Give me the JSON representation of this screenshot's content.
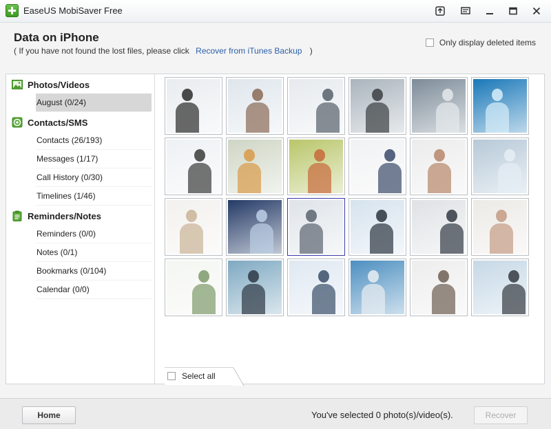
{
  "app": {
    "title": "EaseUS MobiSaver Free"
  },
  "window_controls": [
    "upload-icon",
    "feedback-icon",
    "minimize-icon",
    "maximize-icon",
    "close-icon"
  ],
  "header": {
    "title": "Data on iPhone",
    "hint_prefix": "( If you have not found the lost files, please click",
    "hint_link": "Recover from iTunes Backup",
    "hint_suffix": ")",
    "only_deleted_label": "Only display deleted items"
  },
  "sidebar": {
    "categories": [
      {
        "label": "Photos/Videos",
        "icon": "photo-icon",
        "items": [
          "August (0/24)"
        ]
      },
      {
        "label": "Contacts/SMS",
        "icon": "contacts-icon",
        "items": [
          "Contacts (26/193)",
          "Messages (1/17)",
          "Call History (0/30)",
          "Timelines (1/46)"
        ]
      },
      {
        "label": "Reminders/Notes",
        "icon": "clipboard-icon",
        "items": [
          "Reminders (0/0)",
          "Notes (0/1)",
          "Bookmarks (0/104)",
          "Calendar (0/0)"
        ]
      }
    ],
    "selected_item": "August (0/24)"
  },
  "photos": {
    "count": 24,
    "items": [
      {
        "bg": "#e9ecef",
        "fg": "#2b2b2b"
      },
      {
        "bg": "#dfe6ec",
        "fg": "#8a6a55"
      },
      {
        "bg": "#e6eaee",
        "fg": "#55606a"
      },
      {
        "bg": "#aab4bd",
        "fg": "#3b3e42"
      },
      {
        "bg": "#7d8c99",
        "fg": "#e5e9ec"
      },
      {
        "bg": "#1a78b8",
        "fg": "#d7eefa"
      },
      {
        "bg": "#eef1f4",
        "fg": "#3a3a3a"
      },
      {
        "bg": "#cfd6c5",
        "fg": "#d89a48"
      },
      {
        "bg": "#b9c66a",
        "fg": "#c76a3a"
      },
      {
        "bg": "#f1f2f3",
        "fg": "#3a4a6a"
      },
      {
        "bg": "#ececec",
        "fg": "#b7866a"
      },
      {
        "bg": "#b7c9d8",
        "fg": "#e6eef5"
      },
      {
        "bg": "#f3f1ee",
        "fg": "#c9b496"
      },
      {
        "bg": "#243a66",
        "fg": "#bcd0e6"
      },
      {
        "bg": "#dfe4e9",
        "fg": "#5b6470"
      },
      {
        "bg": "#d6e3ee",
        "fg": "#2c3440"
      },
      {
        "bg": "#dfe2e5",
        "fg": "#333a44"
      },
      {
        "bg": "#eceae6",
        "fg": "#c59b84"
      },
      {
        "bg": "#f4f6f2",
        "fg": "#7e9a6a"
      },
      {
        "bg": "#7fa9c2",
        "fg": "#2e3844"
      },
      {
        "bg": "#dfe8f2",
        "fg": "#3a4e68"
      },
      {
        "bg": "#4d8fc0",
        "fg": "#e9eef2"
      },
      {
        "bg": "#ededed",
        "fg": "#6d5e52"
      },
      {
        "bg": "#c6d8e6",
        "fg": "#343a40"
      }
    ],
    "highlighted_index": 14
  },
  "grid": {
    "select_all_label": "Select all"
  },
  "footer": {
    "home_label": "Home",
    "status_text": "You've selected 0 photo(s)/video(s).",
    "recover_label": "Recover"
  },
  "colors": {
    "link": "#2a5ea8",
    "selected_row": "#d7d7d7",
    "logo_green": "#4caf2e"
  }
}
